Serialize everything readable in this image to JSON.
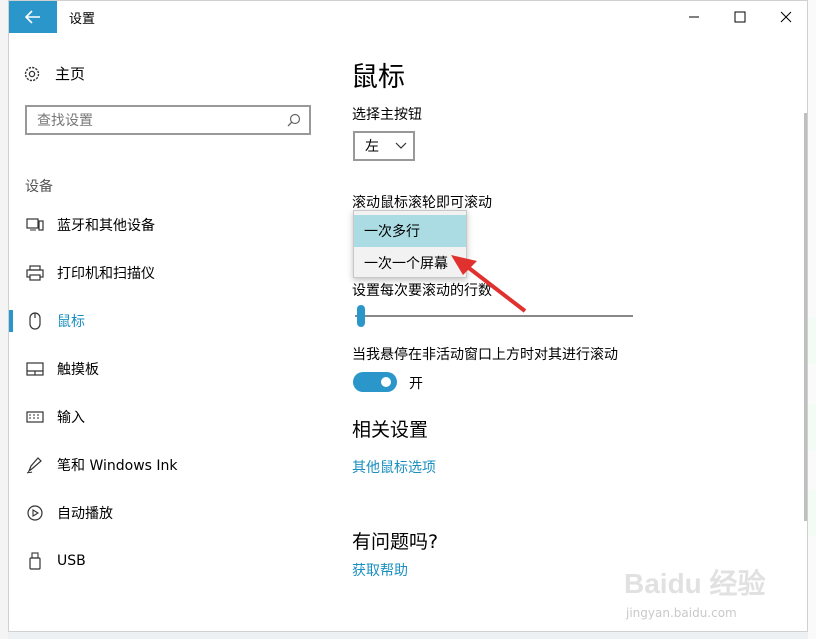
{
  "window": {
    "title": "设置",
    "controls": {
      "minimize": "—",
      "maximize": "☐",
      "close": "✕"
    }
  },
  "sidebar": {
    "home_label": "主页",
    "search_placeholder": "查找设置",
    "section_label": "设备",
    "items": [
      {
        "label": "蓝牙和其他设备",
        "icon": "bluetooth-devices-icon"
      },
      {
        "label": "打印机和扫描仪",
        "icon": "printer-icon"
      },
      {
        "label": "鼠标",
        "icon": "mouse-icon",
        "active": true
      },
      {
        "label": "触摸板",
        "icon": "touchpad-icon"
      },
      {
        "label": "输入",
        "icon": "keyboard-icon"
      },
      {
        "label": "笔和 Windows Ink",
        "icon": "pen-icon"
      },
      {
        "label": "自动播放",
        "icon": "autoplay-icon"
      },
      {
        "label": "USB",
        "icon": "usb-icon"
      }
    ]
  },
  "main": {
    "title": "鼠标",
    "primary_button_label": "选择主按钮",
    "primary_button_value": "左",
    "scroll_label": "滚动鼠标滚轮即可滚动",
    "scroll_options": [
      "一次多行",
      "一次一个屏幕"
    ],
    "lines_label_visible": "设置每次要滚动的行数",
    "lines_value": 1,
    "inactive_scroll_label": "当我悬停在非活动窗口上方时对其进行滚动",
    "toggle_state": "开",
    "related_heading": "相关设置",
    "related_link": "其他鼠标选项",
    "question_heading": "有问题吗?",
    "help_link": "获取帮助"
  },
  "watermark": {
    "main": "Baidu 经验",
    "sub": "jingyan.baidu.com"
  },
  "colors": {
    "accent": "#2b96c9",
    "link": "#1a8fbf",
    "highlight": "#abdbe3",
    "arrow": "#e0312f"
  }
}
